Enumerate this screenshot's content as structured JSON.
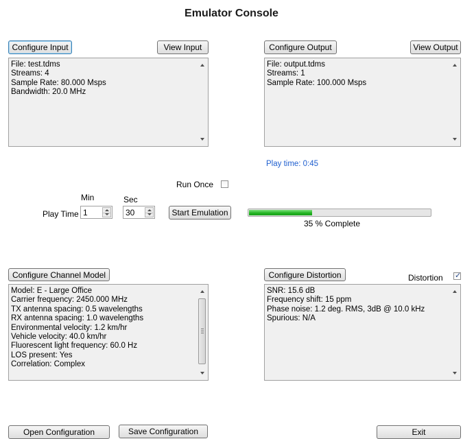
{
  "window": {
    "title": "Emulator Console"
  },
  "input": {
    "configure_label": "Configure Input",
    "view_label": "View Input",
    "lines": [
      "File: test.tdms",
      "Streams: 4",
      "Sample Rate: 80.000 Msps",
      "Bandwidth:  20.0 MHz"
    ]
  },
  "output": {
    "configure_label": "Configure Output",
    "view_label": "View Output",
    "lines": [
      "File: output.tdms",
      "Streams: 1",
      "Sample Rate: 100.000 Msps"
    ],
    "play_time_text": "Play time:  0:45",
    "play_time_color": "#1f5fcf"
  },
  "playback": {
    "run_once_label": "Run Once",
    "run_once_checked": false,
    "min_label": "Min",
    "sec_label": "Sec",
    "play_time_label": "Play Time",
    "min_value": "1",
    "sec_value": "30",
    "start_label": "Start Emulation",
    "progress_fraction": 0.35,
    "progress_text": "35 % Complete",
    "progress_color": "#21b321"
  },
  "channel": {
    "configure_label": "Configure Channel Model",
    "lines": [
      "Model: E - Large Office",
      "Carrier frequency:  2450.000 MHz",
      "TX antenna spacing:  0.5 wavelengths",
      "RX antenna spacing:  1.0 wavelengths",
      "Environmental velocity:  1.2 km/hr",
      "Vehicle velocity:  40.0 km/hr",
      "Fluorescent light frequency:  60.0 Hz",
      "LOS present: Yes",
      "Correlation: Complex"
    ]
  },
  "distortion": {
    "configure_label": "Configure Distortion",
    "checkbox_label": "Distortion",
    "checked": true,
    "lines": [
      "SNR:  15.6 dB",
      "Frequency shift: 15 ppm",
      "Phase noise:  1.2 deg. RMS, 3dB @ 10.0 kHz",
      "Spurious: N/A"
    ]
  },
  "footer": {
    "open_label": "Open Configuration",
    "save_label": "Save Configuration",
    "exit_label": "Exit"
  }
}
